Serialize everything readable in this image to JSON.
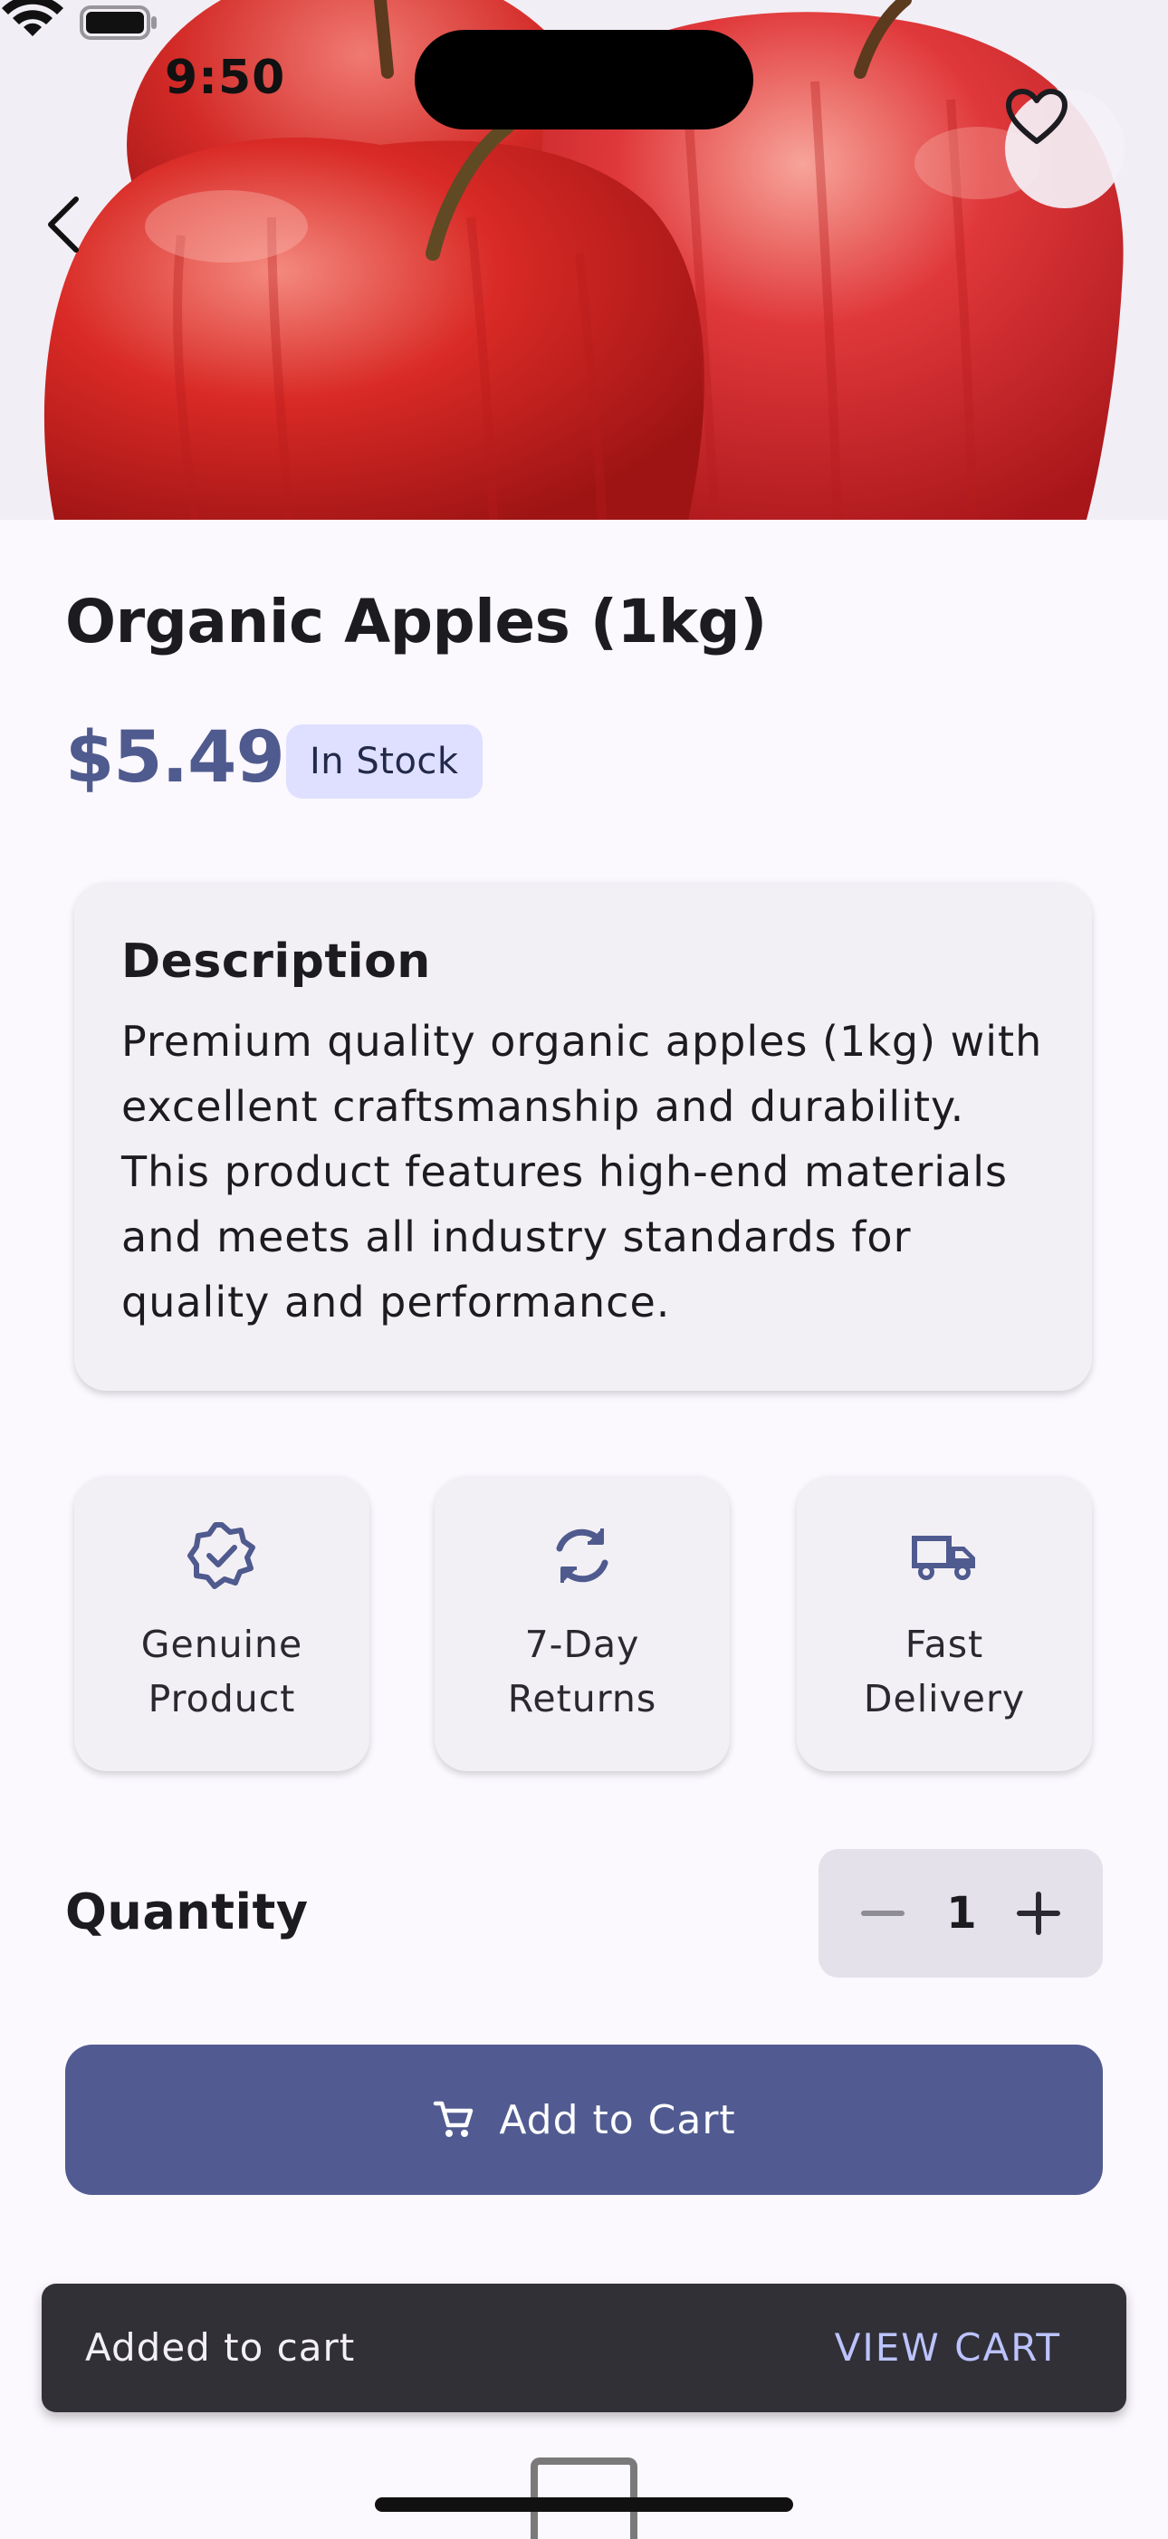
{
  "status_bar": {
    "time": "9:50"
  },
  "hero": {
    "image_subject": "red apples",
    "favorite_icon": "heart-outline-icon",
    "back_icon": "chevron-left-icon"
  },
  "product": {
    "title": "Organic Apples (1kg)",
    "price": "$5.49",
    "stock_badge": "In Stock"
  },
  "description": {
    "heading": "Description",
    "body": "Premium quality organic apples (1kg) with excellent craftsmanship and durability. This product features high-end materials and meets all industry standards for quality and performance."
  },
  "features": [
    {
      "icon": "verified-badge-icon",
      "line1": "Genuine",
      "line2": "Product"
    },
    {
      "icon": "sync-icon",
      "line1": "7-Day",
      "line2": "Returns"
    },
    {
      "icon": "truck-icon",
      "line1": "Fast",
      "line2": "Delivery"
    }
  ],
  "quantity": {
    "label": "Quantity",
    "value": "1"
  },
  "cart_button": {
    "label": "Add to Cart",
    "icon": "cart-icon"
  },
  "snackbar": {
    "message": "Added to cart",
    "action": "VIEW CART"
  },
  "colors": {
    "accent": "#515b91",
    "badge_bg": "#dfe0ff",
    "snackbar_bg": "#313036",
    "snackbar_action": "#bcc3ff"
  }
}
